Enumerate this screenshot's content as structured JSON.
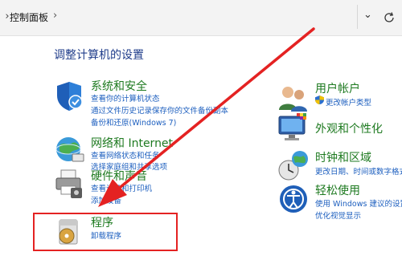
{
  "address_bar": {
    "breadcrumb": "控制面板",
    "icons": [
      "chevron-right-icon",
      "chevron-down-icon",
      "refresh-icon"
    ]
  },
  "page_title": "调整计算机的设置",
  "left_categories": [
    {
      "title": "系统和安全",
      "links": [
        "查看你的计算机状态",
        "通过文件历史记录保存你的文件备份副本",
        "备份和还原(Windows 7)"
      ],
      "icon": "shield-icon"
    },
    {
      "title": "网络和 Internet",
      "links": [
        "查看网络状态和任务",
        "选择家庭组和共享选项"
      ],
      "icon": "network-globe-icon"
    },
    {
      "title": "硬件和声音",
      "links": [
        "查看设备和打印机",
        "添加设备"
      ],
      "icon": "printer-icon"
    },
    {
      "title": "程序",
      "links": [
        "卸载程序"
      ],
      "icon": "programs-disc-icon"
    }
  ],
  "right_categories": [
    {
      "title": "用户帐户",
      "links": [
        "更改帐户类型"
      ],
      "icon": "users-icon"
    },
    {
      "title": "外观和个性化",
      "links": [],
      "icon": "display-palette-icon"
    },
    {
      "title": "时钟和区域",
      "links": [
        "更改日期、时间或数字格式"
      ],
      "icon": "clock-globe-icon"
    },
    {
      "title": "轻松使用",
      "links": [
        "使用 Windows 建议的设置",
        "优化视觉显示"
      ],
      "icon": "ease-of-access-icon"
    }
  ],
  "annotation": {
    "color": "#e42222"
  }
}
